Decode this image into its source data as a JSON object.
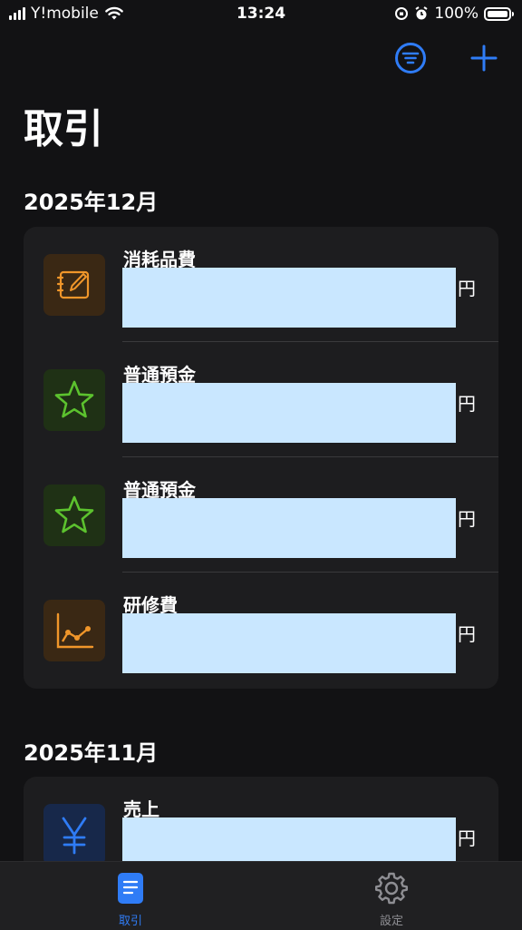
{
  "status_bar": {
    "carrier": "Y!mobile",
    "time": "13:24",
    "battery": "100%"
  },
  "nav": {
    "filter_icon": "filter-circle-icon",
    "add_icon": "plus-icon"
  },
  "title": "取引",
  "sections": [
    {
      "header": "2025年12月",
      "transactions": [
        {
          "name": "消耗品費",
          "icon": "notebook-pencil-icon",
          "currency": "円"
        },
        {
          "name": "普通預金",
          "icon": "star-icon",
          "currency": "円"
        },
        {
          "name": "普通預金",
          "icon": "star-icon",
          "currency": "円"
        },
        {
          "name": "研修費",
          "icon": "line-chart-icon",
          "currency": "円"
        }
      ]
    },
    {
      "header": "2025年11月",
      "transactions": [
        {
          "name": "売上",
          "icon": "yen-icon",
          "currency": "円"
        }
      ]
    }
  ],
  "tab_bar": {
    "tabs": [
      {
        "label": "取引",
        "icon": "document-icon",
        "selected": true
      },
      {
        "label": "設定",
        "icon": "gear-icon",
        "selected": false
      }
    ]
  },
  "colors": {
    "accent": "#2f7cf6",
    "background": "#121214",
    "card": "#1d1d1f",
    "redacted": "#c9e7ff",
    "orange_icon": "#f0962a",
    "green_icon": "#5cc22e",
    "blue_icon": "#2f7cf6"
  }
}
